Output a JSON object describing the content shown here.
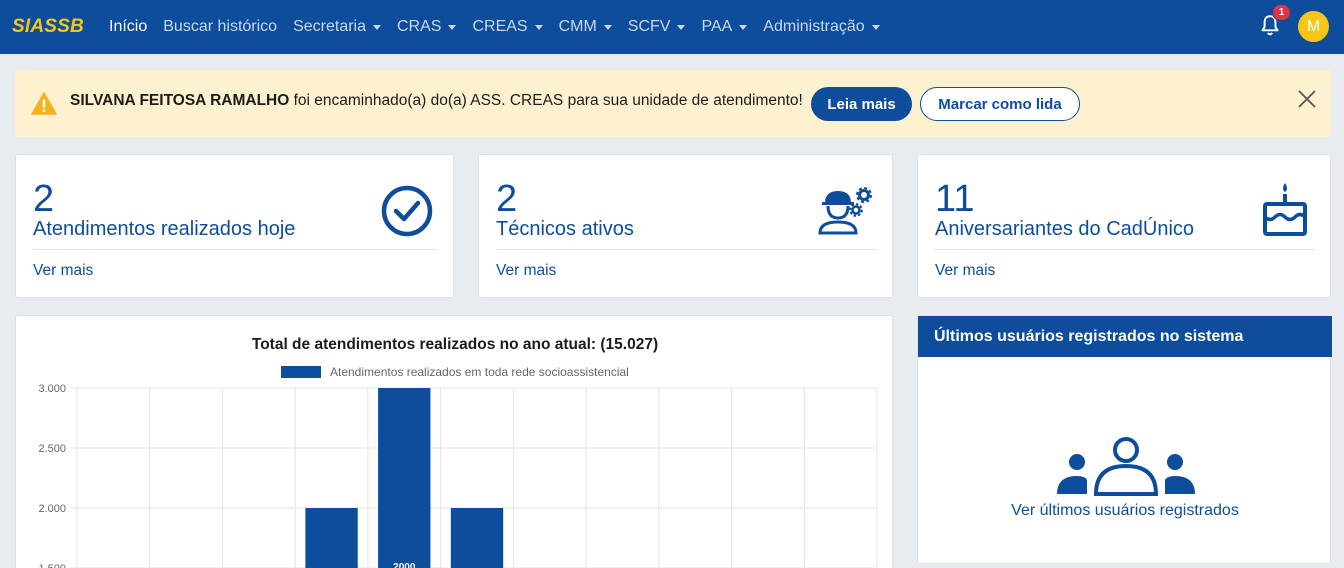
{
  "navbar": {
    "brand": "SIASSB",
    "items": [
      {
        "label": "Início",
        "dropdown": false,
        "active": true
      },
      {
        "label": "Buscar histórico",
        "dropdown": false,
        "active": false
      },
      {
        "label": "Secretaria",
        "dropdown": true,
        "active": false
      },
      {
        "label": "CRAS",
        "dropdown": true,
        "active": false
      },
      {
        "label": "CREAS",
        "dropdown": true,
        "active": false
      },
      {
        "label": "CMM",
        "dropdown": true,
        "active": false
      },
      {
        "label": "SCFV",
        "dropdown": true,
        "active": false
      },
      {
        "label": "PAA",
        "dropdown": true,
        "active": false
      },
      {
        "label": "Administração",
        "dropdown": true,
        "active": false
      }
    ],
    "notification_count": "1",
    "avatar_initial": "M"
  },
  "alert": {
    "name": "SILVANA FEITOSA RAMALHO",
    "message": " foi encaminhado(a) do(a) ASS. CREAS para sua unidade de atendimento!",
    "read_more": "Leia mais",
    "mark_read": "Marcar como lida"
  },
  "stats": [
    {
      "value": "2",
      "label": "Atendimentos realizados hoje",
      "link": "Ver mais",
      "icon": "check-circle-icon"
    },
    {
      "value": "2",
      "label": "Técnicos ativos",
      "link": "Ver mais",
      "icon": "engineer-gears-icon"
    },
    {
      "value": "11",
      "label": "Aniversariantes do CadÚnico",
      "link": "Ver mais",
      "icon": "birthday-cake-icon"
    }
  ],
  "users_panel": {
    "title": "Últimos usuários registrados no sistema",
    "link": "Ver últimos usuários registrados",
    "icon": "users-group-icon"
  },
  "colors": {
    "primary": "#0d4d9b",
    "brand": "#f5c518",
    "alert_bg": "#fdf1cf",
    "badge": "#dc3545"
  },
  "chart_data": {
    "type": "bar",
    "title": "Total de atendimentos realizados no ano atual: (15.027)",
    "series": [
      {
        "name": "Atendimentos realizados em toda rede socioassistencial",
        "values": [
          0,
          0,
          0,
          2000,
          3000,
          2000,
          0,
          0,
          1500,
          0,
          0
        ]
      }
    ],
    "data_labels": [
      {
        "index": 4,
        "text": "2000"
      }
    ],
    "y_ticks": [
      "3.000",
      "2.500",
      "2.000",
      "1.500"
    ],
    "ylim": [
      1500,
      3000
    ],
    "grid": true,
    "legend": "top"
  }
}
